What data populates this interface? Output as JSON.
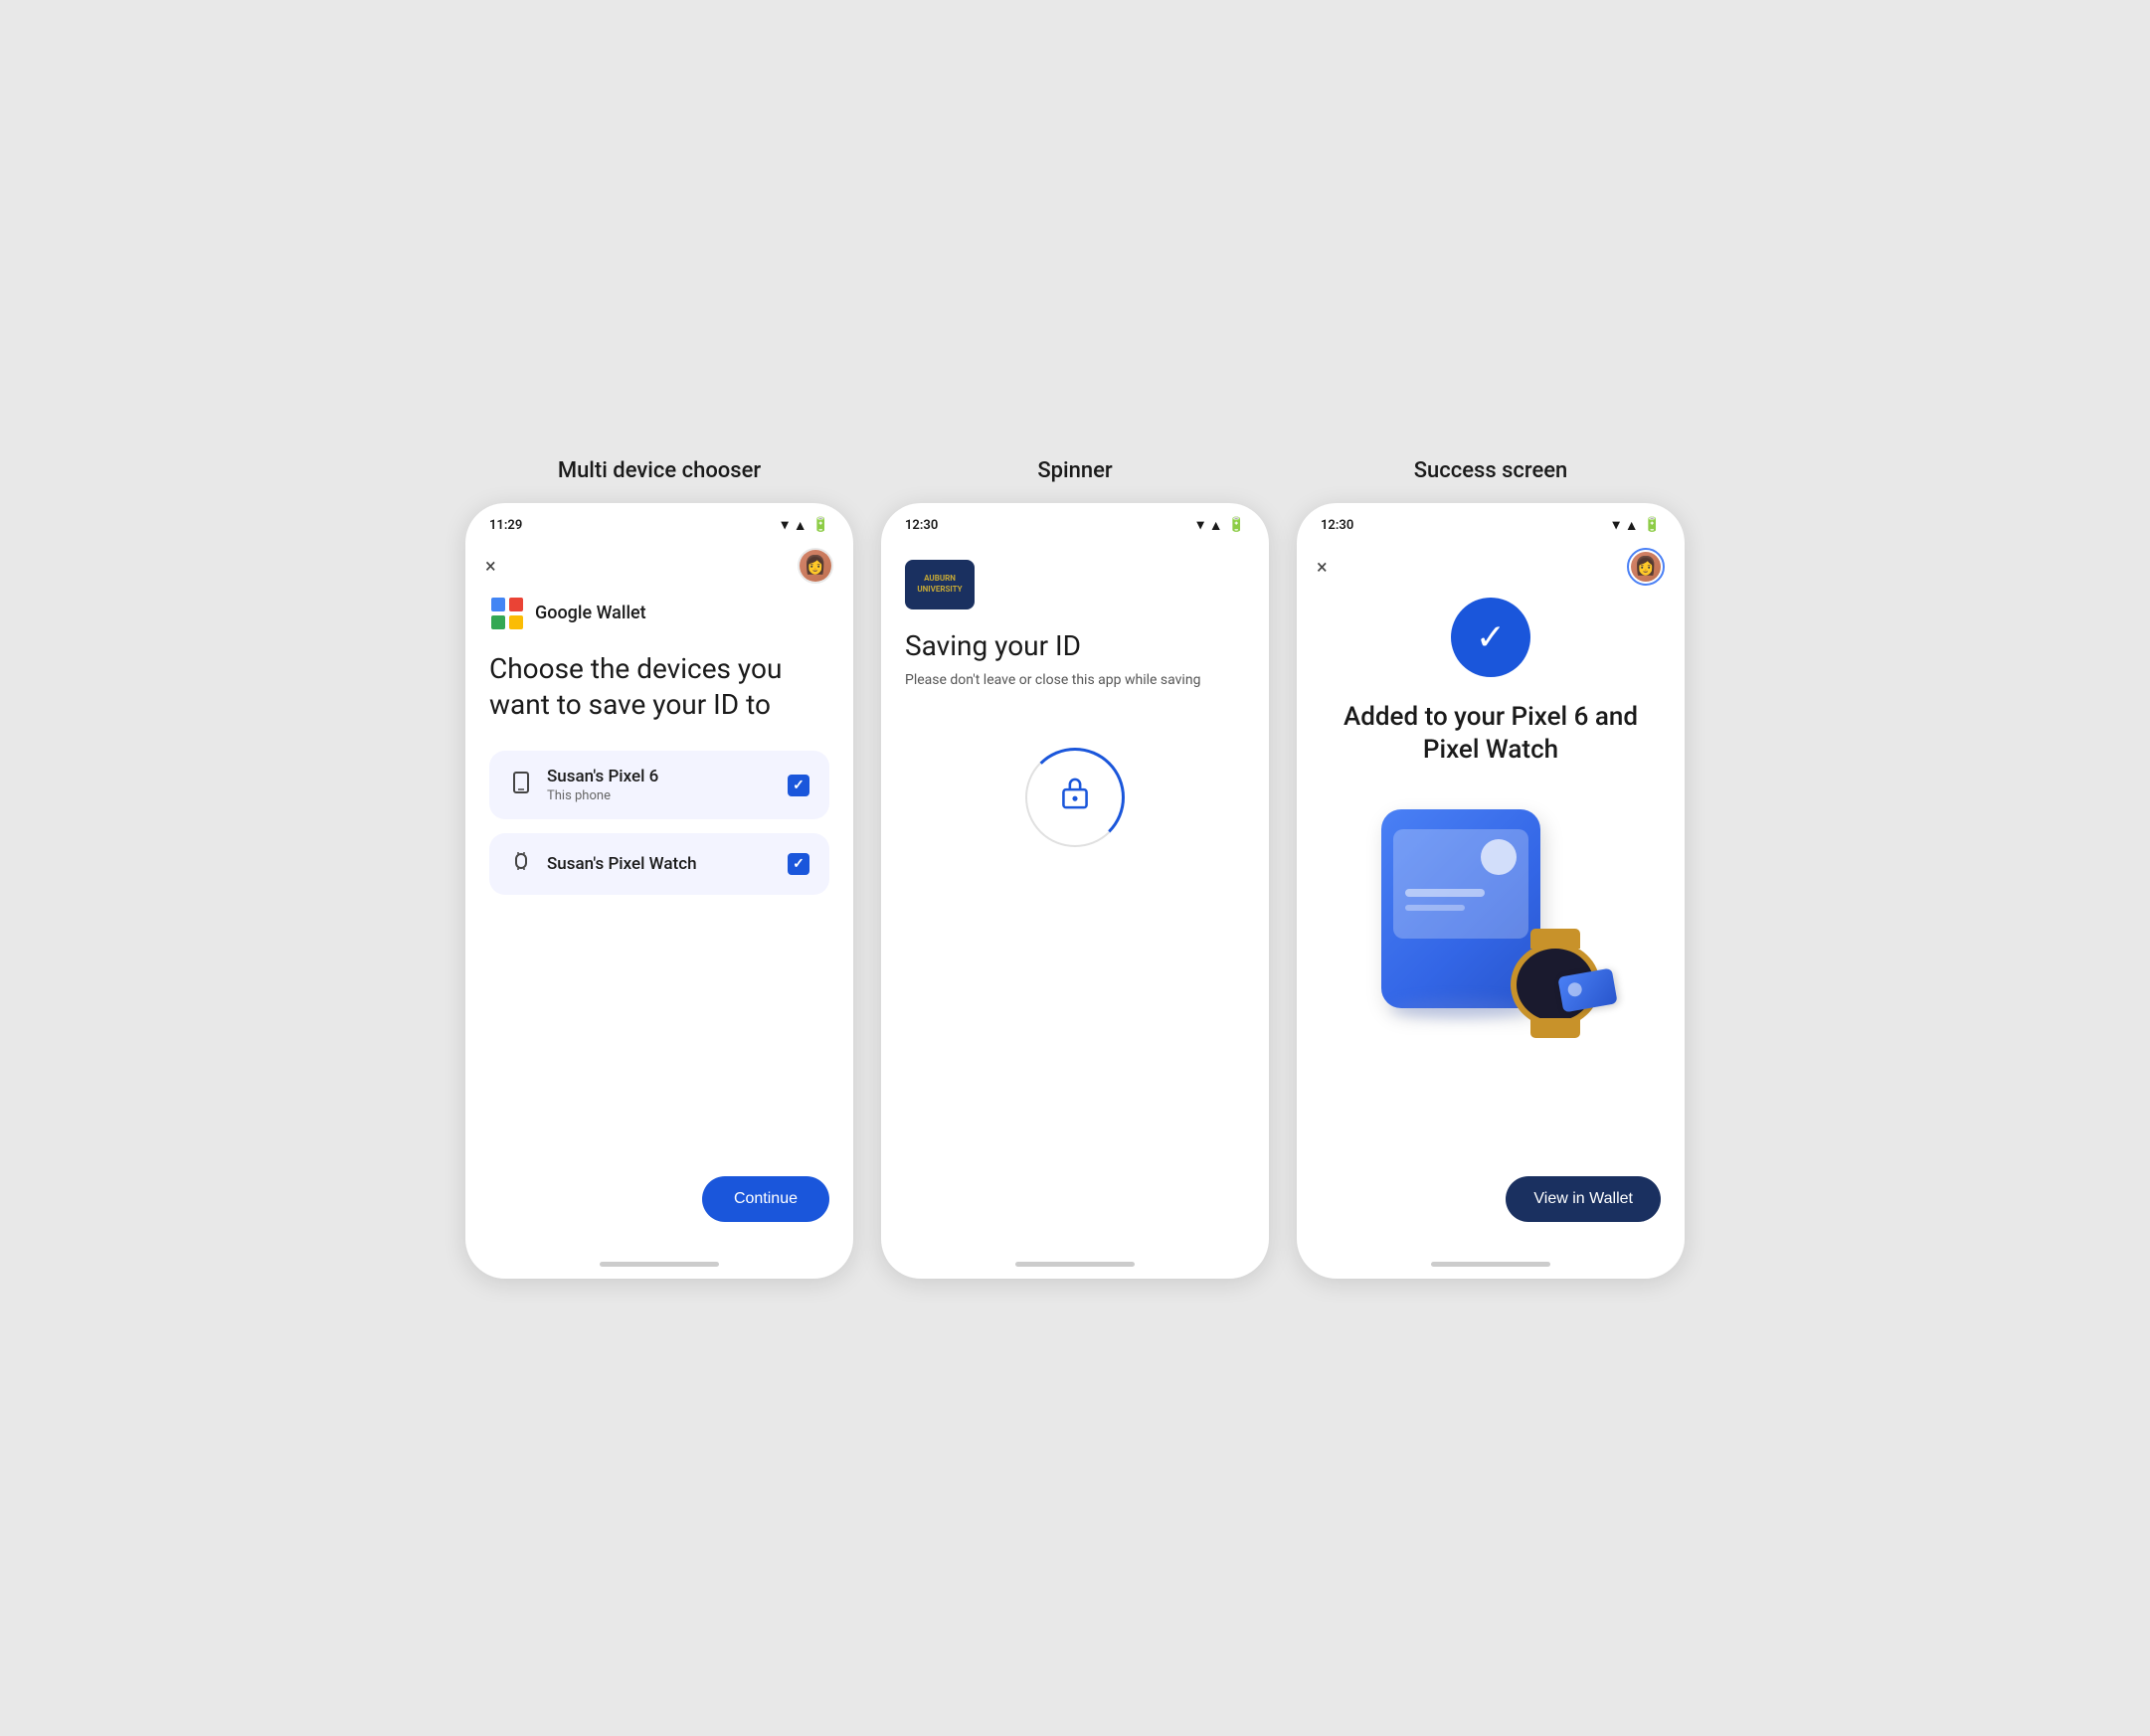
{
  "screens": [
    {
      "label": "Multi device chooser",
      "statusTime": "11:29",
      "topBar": {
        "closeIcon": "×",
        "showAvatar": true,
        "avatarRing": false
      },
      "walletHeader": {
        "logoAlt": "Google Wallet logo",
        "title": "Google Wallet"
      },
      "heading": "Choose the devices you want to save your ID to",
      "devices": [
        {
          "icon": "📱",
          "name": "Susan's Pixel 6",
          "sub": "This phone",
          "checked": true
        },
        {
          "icon": "⌚",
          "name": "Susan's Pixel Watch",
          "sub": "",
          "checked": true
        }
      ],
      "continueButton": "Continue"
    },
    {
      "label": "Spinner",
      "statusTime": "12:30",
      "topBar": {
        "closeIcon": "",
        "showAvatar": false
      },
      "badgeText": "AUBURN\nUNIVERSITY",
      "heading": "Saving your ID",
      "subText": "Please don't leave or close this app while saving",
      "spinnerLabel": "lock"
    },
    {
      "label": "Success screen",
      "statusTime": "12:30",
      "topBar": {
        "closeIcon": "×",
        "showAvatar": true,
        "avatarRing": true
      },
      "successIcon": "✓",
      "heading": "Added to your Pixel 6 and Pixel Watch",
      "viewWalletButton": "View in Wallet"
    }
  ]
}
